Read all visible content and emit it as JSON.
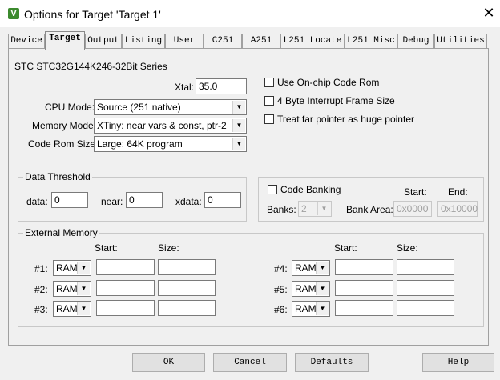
{
  "window": {
    "title": "Options for Target 'Target 1'",
    "close_glyph": "✕",
    "app_icon_glyph": "V"
  },
  "tabs": [
    "Device",
    "Target",
    "Output",
    "Listing",
    "User",
    "C251",
    "A251",
    "L251 Locate",
    "L251 Misc",
    "Debug",
    "Utilities"
  ],
  "active_tab": "Target",
  "device_name": "STC STC32G144K246-32Bit Series",
  "xtal": {
    "label": "Xtal:",
    "value": "35.0"
  },
  "cpu_mode": {
    "label": "CPU Mode:",
    "value": "Source (251 native)"
  },
  "memory_model": {
    "label": "Memory Model:",
    "value": "XTiny: near vars & const, ptr-2"
  },
  "code_rom_size": {
    "label": "Code Rom Size:",
    "value": "Large: 64K program"
  },
  "options": {
    "on_chip_code_rom": "Use On-chip Code Rom",
    "four_byte_interrupt": "4 Byte Interrupt Frame Size",
    "far_pointer_huge": "Treat far pointer as huge pointer"
  },
  "data_threshold": {
    "title": "Data Threshold",
    "data_label": "data:",
    "data_value": "0",
    "near_label": "near:",
    "near_value": "0",
    "xdata_label": "xdata:",
    "xdata_value": "0"
  },
  "code_banking": {
    "label": "Code Banking",
    "banks_label": "Banks:",
    "banks_value": "2",
    "bank_area_label": "Bank Area:",
    "start_label": "Start:",
    "end_label": "End:",
    "start_value": "0x0000",
    "end_value": "0x10000"
  },
  "external_memory": {
    "title": "External Memory",
    "start_label": "Start:",
    "size_label": "Size:",
    "rows": [
      {
        "label": "#1:",
        "type": "RAM"
      },
      {
        "label": "#2:",
        "type": "RAM"
      },
      {
        "label": "#3:",
        "type": "RAM"
      },
      {
        "label": "#4:",
        "type": "RAM"
      },
      {
        "label": "#5:",
        "type": "RAM"
      },
      {
        "label": "#6:",
        "type": "RAM"
      }
    ]
  },
  "buttons": {
    "ok": "OK",
    "cancel": "Cancel",
    "defaults": "Defaults",
    "help": "Help"
  }
}
